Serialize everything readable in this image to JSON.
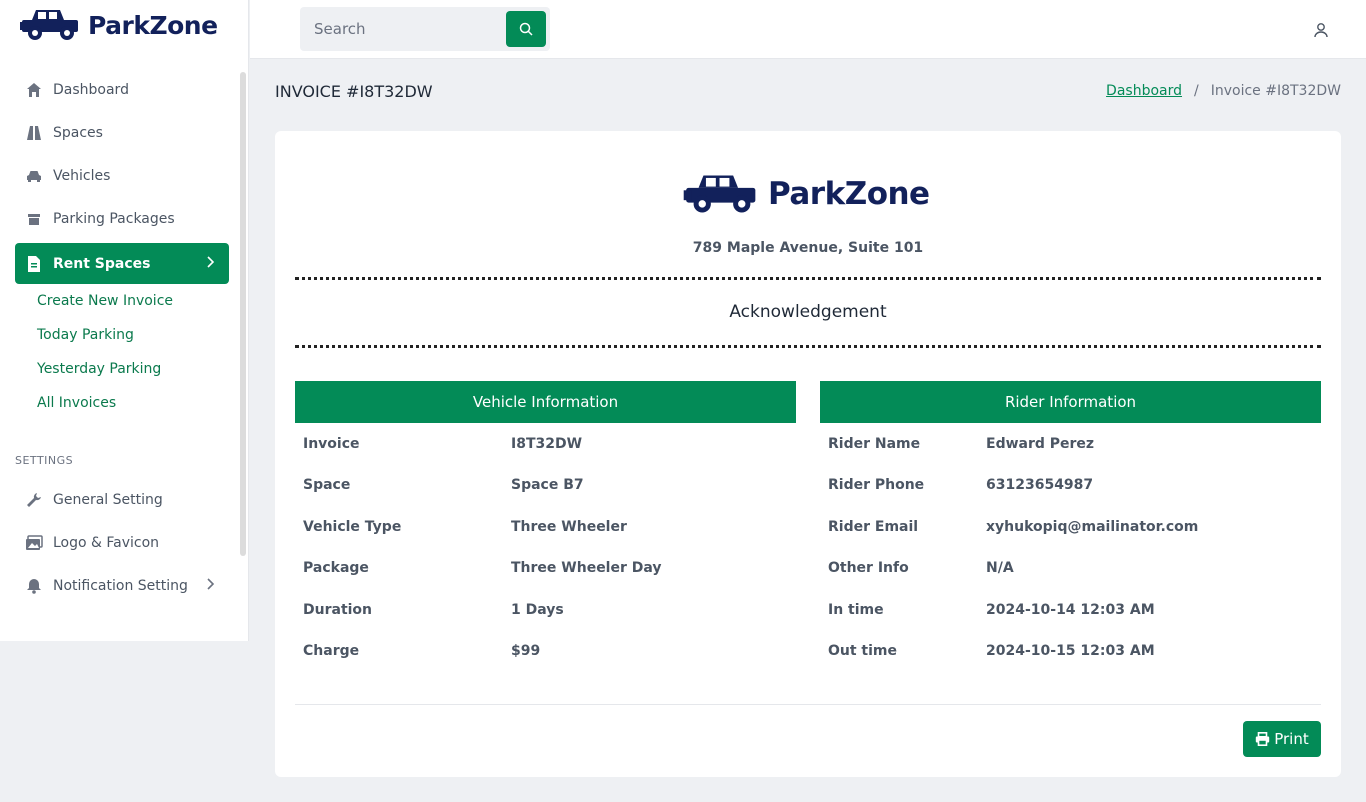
{
  "brand": {
    "name": "ParkZone"
  },
  "search": {
    "placeholder": "Search"
  },
  "sidebar": {
    "items": [
      {
        "label": "Dashboard",
        "icon": "home-icon"
      },
      {
        "label": "Spaces",
        "icon": "road-icon"
      },
      {
        "label": "Vehicles",
        "icon": "car-icon"
      },
      {
        "label": "Parking Packages",
        "icon": "box-icon"
      },
      {
        "label": "Rent Spaces",
        "icon": "file-icon",
        "active": true
      }
    ],
    "submenu": [
      "Create New Invoice",
      "Today Parking",
      "Yesterday Parking",
      "All Invoices"
    ],
    "settings_label": "SETTINGS",
    "settings": [
      {
        "label": "General Setting",
        "icon": "wrench-icon"
      },
      {
        "label": "Logo & Favicon",
        "icon": "images-icon"
      },
      {
        "label": "Notification Setting",
        "icon": "bell-icon"
      }
    ]
  },
  "page": {
    "title": "INVOICE #I8T32DW",
    "breadcrumb": {
      "link": "Dashboard",
      "separator": "/",
      "current": "Invoice #I8T32DW"
    }
  },
  "invoice": {
    "brand": "ParkZone",
    "address": "789 Maple Avenue, Suite 101",
    "heading": "Acknowledgement",
    "vehicle": {
      "title": "Vehicle Information",
      "rows": [
        {
          "k": "Invoice",
          "v": "I8T32DW"
        },
        {
          "k": "Space",
          "v": "Space B7"
        },
        {
          "k": "Vehicle Type",
          "v": "Three Wheeler"
        },
        {
          "k": "Package",
          "v": "Three Wheeler Day"
        },
        {
          "k": "Duration",
          "v": "1 Days"
        },
        {
          "k": "Charge",
          "v": "$99"
        }
      ]
    },
    "rider": {
      "title": "Rider Information",
      "rows": [
        {
          "k": "Rider Name",
          "v": "Edward Perez"
        },
        {
          "k": "Rider Phone",
          "v": "63123654987"
        },
        {
          "k": "Rider Email",
          "v": "xyhukopiq@mailinator.com"
        },
        {
          "k": "Other Info",
          "v": "N/A"
        },
        {
          "k": "In time",
          "v": "2024-10-14 12:03 AM"
        },
        {
          "k": "Out time",
          "v": "2024-10-15 12:03 AM"
        }
      ]
    },
    "print_label": "Print"
  },
  "colors": {
    "accent": "#038b57",
    "brand_navy": "#12215b"
  }
}
